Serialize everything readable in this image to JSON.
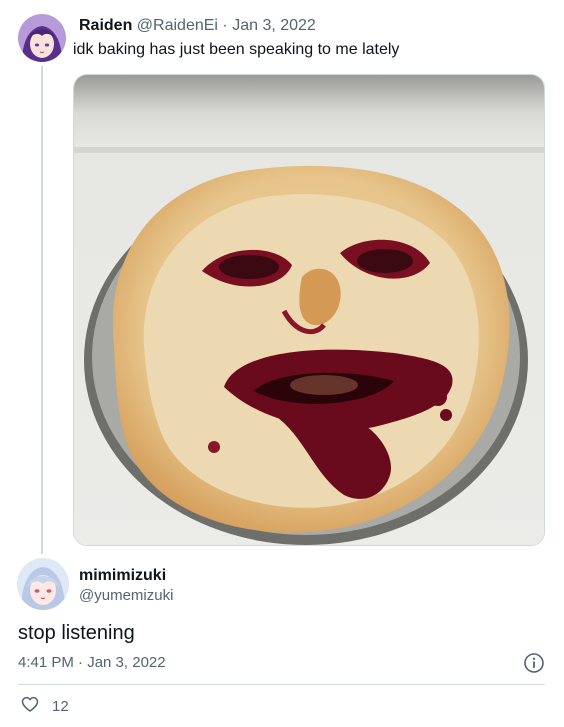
{
  "original_tweet": {
    "name": "Raiden",
    "handle": "@RaidenEi",
    "separator": "·",
    "date": "Jan 3, 2022",
    "text": "idk baking has just been speaking to me lately"
  },
  "reply": {
    "name": "mimimizuki",
    "handle": "@yumemizuki",
    "text": "stop listening",
    "timestamp": "4:41 PM · Jan 3, 2022",
    "like_count": "12"
  },
  "icons": [
    "avatar-raiden",
    "pie-photo",
    "avatar-mimimizuki",
    "info-icon",
    "heart-icon"
  ],
  "colors": {
    "text": "#0f1419",
    "secondary": "#536471",
    "divider": "#cfd9de",
    "crust": "#e3b877",
    "filling": "#7a0f22"
  }
}
